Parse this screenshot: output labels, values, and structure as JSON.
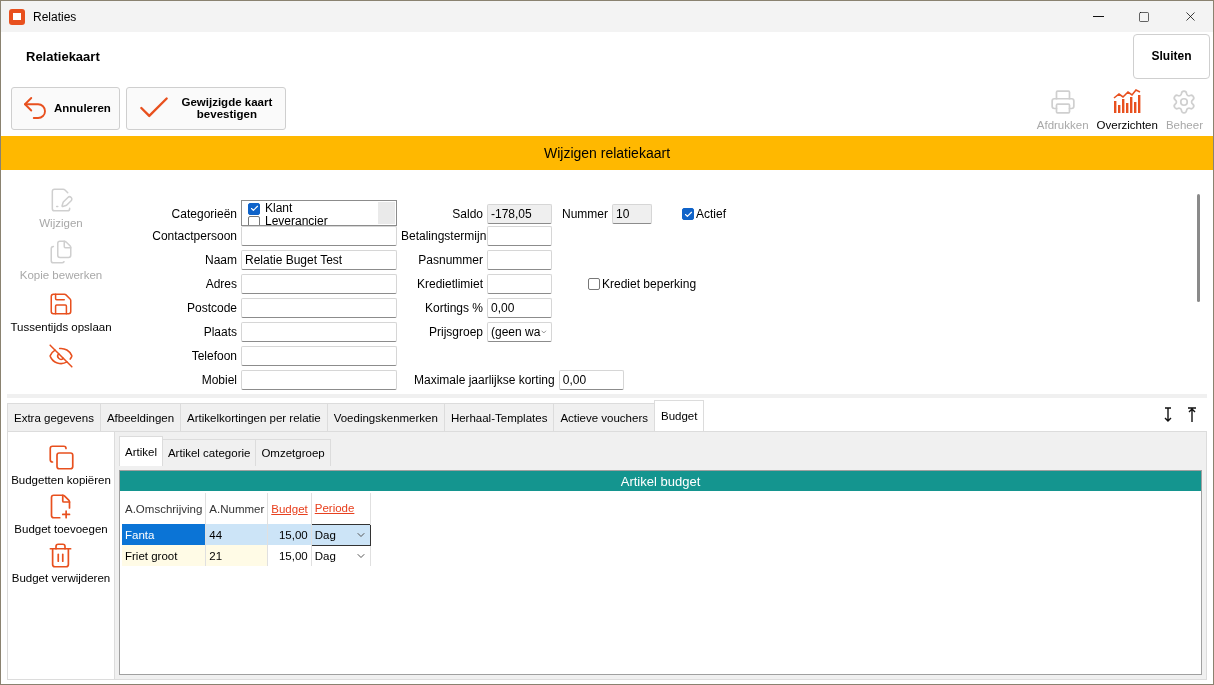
{
  "window": {
    "title": "Relaties"
  },
  "header": {
    "title": "Relatiekaart",
    "close_button": "Sluiten"
  },
  "toolbar": {
    "buttons": [
      {
        "kind": "undo",
        "label": "Annuleren"
      },
      {
        "kind": "confirm",
        "label": "Gewijzigde kaart bevestigen"
      }
    ],
    "actions": [
      {
        "kind": "print",
        "label": "Afdrukken",
        "disabled": true
      },
      {
        "kind": "chart",
        "label": "Overzichten",
        "disabled": false
      },
      {
        "kind": "settings",
        "label": "Beheer",
        "disabled": true
      }
    ]
  },
  "banner": "Wijzigen relatiekaart",
  "side_actions": [
    {
      "kind": "edit",
      "label": "Wijzigen",
      "disabled": true
    },
    {
      "kind": "copy",
      "label": "Kopie bewerken",
      "disabled": true
    },
    {
      "kind": "save",
      "label": "Tussentijds opslaan",
      "disabled": false
    },
    {
      "kind": "hide",
      "disabled": false
    }
  ],
  "form": {
    "rows": [
      {
        "left": {
          "label": "Categorieën",
          "kind": "list",
          "items": [
            {
              "label": "Klant",
              "checked": true
            },
            {
              "label": "Leverancier",
              "checked": false
            }
          ]
        },
        "middle": {
          "kind": "field",
          "label": "Saldo",
          "value": "-178,05",
          "readonly": true
        },
        "extras": [
          {
            "kind": "field",
            "label": "Nummer",
            "value": "10",
            "readonly": true
          },
          {
            "kind": "checkbox",
            "label": "Actief",
            "checked": true
          }
        ]
      },
      {
        "left": {
          "kind": "field",
          "label": "Contactpersoon"
        },
        "middle": {
          "kind": "field",
          "label": "Betalingstermijn",
          "readonly": false
        }
      },
      {
        "left": {
          "kind": "field",
          "label": "Naam",
          "value": "Relatie Buget Test"
        },
        "middle": {
          "kind": "field",
          "label": "Pasnummer",
          "readonly": false
        }
      },
      {
        "left": {
          "kind": "field",
          "label": "Adres"
        },
        "middle": {
          "kind": "field",
          "label": "Kredietlimiet",
          "readonly": false
        },
        "extras": [
          {
            "kind": "checkbox",
            "label": "Krediet beperking",
            "checked": false
          }
        ]
      },
      {
        "left": {
          "kind": "field",
          "label": "Postcode"
        },
        "middle": {
          "kind": "field",
          "label": "Kortings %",
          "value": "0,00",
          "readonly": false
        }
      },
      {
        "left": {
          "kind": "field",
          "label": "Plaats"
        },
        "middle": {
          "kind": "select",
          "label": "Prijsgroep",
          "value": "(geen wa"
        }
      },
      {
        "left": {
          "kind": "field",
          "label": "Telefoon"
        }
      },
      {
        "left": {
          "kind": "field",
          "label": "Mobiel"
        },
        "middle": {
          "kind": "wide",
          "label": "Maximale jaarlijkse korting",
          "value": "0,00"
        }
      }
    ]
  },
  "tabs": [
    {
      "label": "Extra gegevens",
      "selected": false
    },
    {
      "label": "Afbeeldingen",
      "selected": false
    },
    {
      "label": "Artikelkortingen per relatie",
      "selected": false
    },
    {
      "label": "Voedingskenmerken",
      "selected": false
    },
    {
      "label": "Herhaal-Templates",
      "selected": false
    },
    {
      "label": "Actieve vouchers",
      "selected": false
    },
    {
      "label": "Budget",
      "selected": true
    }
  ],
  "budget": {
    "actions": [
      {
        "kind": "copy",
        "label": "Budgetten kopiëren"
      },
      {
        "kind": "add",
        "label": "Budget toevoegen"
      },
      {
        "kind": "delete",
        "label": "Budget verwijderen"
      }
    ],
    "subtabs": [
      {
        "label": "Artikel",
        "selected": true
      },
      {
        "label": "Artikel categorie",
        "selected": false
      },
      {
        "label": "Omzetgroep",
        "selected": false
      }
    ],
    "table": {
      "title": "Artikel budget",
      "columns": [
        {
          "label": "A.Omschrijving",
          "editable": false,
          "kind": "text"
        },
        {
          "label": "A.Nummer",
          "editable": false,
          "kind": "text"
        },
        {
          "label": "Budget",
          "editable": true,
          "kind": "number"
        },
        {
          "label": "Periode",
          "editable": true,
          "kind": "select"
        }
      ],
      "rows": [
        {
          "selected": true,
          "cells": [
            "Fanta",
            "44",
            "15,00",
            "Dag"
          ]
        },
        {
          "selected": false,
          "cells": [
            "Friet groot",
            "21",
            "15,00",
            "Dag"
          ]
        }
      ]
    }
  }
}
